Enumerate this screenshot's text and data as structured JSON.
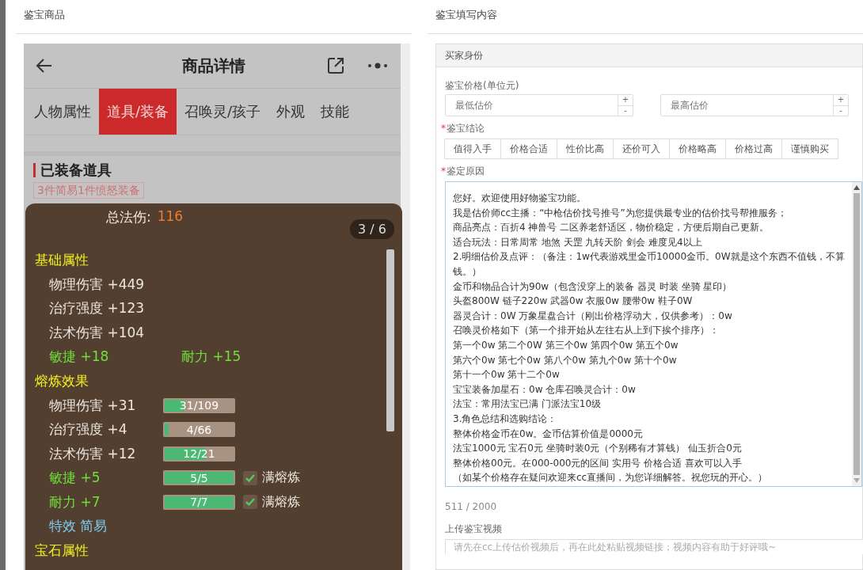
{
  "left_panel": {
    "title": "鉴宝商品"
  },
  "phone": {
    "title": "商品详情",
    "tabs": [
      {
        "label": "人物属性",
        "selected": false
      },
      {
        "label": "道具/装备",
        "selected": true
      },
      {
        "label": "召唤灵/孩子",
        "selected": false
      },
      {
        "label": "外观",
        "selected": false
      },
      {
        "label": "技能",
        "selected": false
      }
    ],
    "section_title": "已装备道具",
    "tag": "3件简易1件愤怒装备"
  },
  "popup": {
    "total_label": "总法伤:",
    "total_value": "116",
    "pager": "3 / 6",
    "sections": [
      {
        "title": "基础属性",
        "rows": [
          {
            "kind": "plain",
            "items": [
              {
                "text": "物理伤害 +449",
                "color": "#ece6df"
              }
            ]
          },
          {
            "kind": "plain",
            "items": [
              {
                "text": "治疗强度 +123",
                "color": "#ece6df"
              }
            ]
          },
          {
            "kind": "plain",
            "items": [
              {
                "text": "法术伤害 +104",
                "color": "#ece6df"
              }
            ]
          },
          {
            "kind": "plain",
            "items": [
              {
                "text": "敏捷 +18",
                "color": "#6fe03a"
              },
              {
                "text": "耐力 +15",
                "color": "#6fe03a"
              }
            ]
          }
        ]
      },
      {
        "title": "熔炼效果",
        "rows": [
          {
            "kind": "bar",
            "text": "物理伤害 +31",
            "color": "#ece6df",
            "reading": "31/109",
            "level": 0.28,
            "checked": false
          },
          {
            "kind": "bar",
            "text": "治疗强度 +4",
            "color": "#ece6df",
            "reading": "4/66",
            "level": 0.06,
            "checked": false
          },
          {
            "kind": "bar",
            "text": "法术伤害 +12",
            "color": "#ece6df",
            "reading": "12/21",
            "level": 0.57,
            "checked": false
          },
          {
            "kind": "bar",
            "text": "敏捷 +5",
            "color": "#6fe03a",
            "reading": "5/5",
            "level": 1,
            "checked": true,
            "check_label": "满熔炼"
          },
          {
            "kind": "bar",
            "text": "耐力 +7",
            "color": "#6fe03a",
            "reading": "7/7",
            "level": 1,
            "checked": true,
            "check_label": "满熔炼"
          },
          {
            "kind": "plain",
            "items": [
              {
                "text": "特效 简易",
                "color": "#7ecdf0"
              }
            ]
          }
        ]
      },
      {
        "title": "宝石属性"
      }
    ]
  },
  "right_panel": {
    "title": "鉴宝填写内容",
    "card_title": "买家身份",
    "price_label": "鉴宝价格(单位元)",
    "price_fields": [
      {
        "placeholder": "最低估价",
        "up": "+",
        "down": "-"
      },
      {
        "placeholder": "最高估价",
        "up": "+",
        "down": "-"
      }
    ],
    "conclusion_label": "鉴宝结论",
    "required_mark": "*",
    "conclusions": [
      {
        "label": "值得入手",
        "selected": false
      },
      {
        "label": "价格合适",
        "selected": false
      },
      {
        "label": "性价比高",
        "selected": false
      },
      {
        "label": "还价可入",
        "selected": false
      },
      {
        "label": "价格略高",
        "selected": false
      },
      {
        "label": "价格过高",
        "selected": false
      },
      {
        "label": "谨慎购买",
        "selected": false
      }
    ],
    "reason_label": "鉴定原因",
    "reason_lines": [
      "您好。欢迎使用好物鉴宝功能。",
      "我是估价师cc主播：“中枪估价找号推号”为您提供最专业的估价找号帮推服务；",
      "商品亮点：百折4 神兽号 二区养老舒适区，物价稳定，方便后期自己更新。",
      "适合玩法：日常周常 地煞 天罡 九转天阶 剑会  难度见4以上",
      "2.明细估价及点评：（备注：1w代表游戏里金币10000金币。0W就是这个东西不值钱，不算钱。）",
      "金币和物品合计为90w（包含没穿上的装备 器灵 时装 坐骑 星印）",
      "头盔800W 链子220w 武器0w 衣服0w 腰带0w 鞋子0W",
      "器灵合计：0W  万象星盘合计（刚出价格浮动大，仅供参考）：0w",
      "召唤灵价格如下（第一个排开始从左往右从上到下挨个排序）：",
      "第一个0w 第二个0W  第三个0w  第四个0w  第五个0w",
      "第六个0w  第七个0w  第八个0w   第九个0w  第十个0w",
      "第十一个0w 第十二个0w",
      "宝宝装备加星石：0w     仓库召唤灵合计：0w",
      "法宝：常用法宝已满 门派法宝10级",
      "3.角色总结和选购结论：",
      "整体价格金币在0w。金币估算价值是0000元",
      "法宝1000元 宝石0元  坐骑时装0元（个别稀有才算钱） 仙玉折合0元",
      "整体价格00元。在000-000元的区间 实用号 价格合适 喜欢可以入手",
      " （如某个价格存在疑问欢迎来cc直播间，为您详细解答。祝您玩的开心。）"
    ],
    "counter": "511 / 2000",
    "video_label": "上传鉴宝视频",
    "video_placeholder": "请先在cc上传估价视频后，再在此处粘贴视频链接；视频内容有助于好评哦~"
  }
}
